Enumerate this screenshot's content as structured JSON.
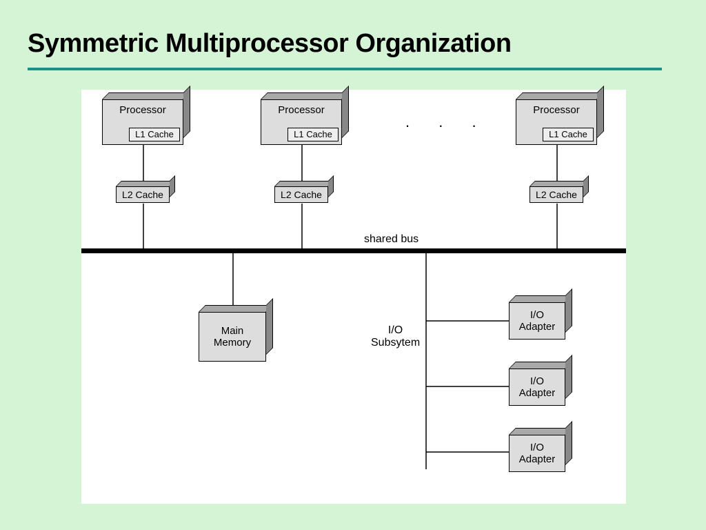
{
  "title": "Symmetric Multiprocessor Organization",
  "labels": {
    "processor": "Processor",
    "l1": "L1 Cache",
    "l2": "L2 Cache",
    "bus": "shared bus",
    "main_memory": "Main\nMemory",
    "io_subsystem": "I/O\nSubsytem",
    "io_adapter": "I/O\nAdapter",
    "ellipsis": ".   .   ."
  },
  "diagram": {
    "processors": 3,
    "io_adapters": 3,
    "ellipsis_after_processor_index": 1,
    "connections": [
      "processor[i] → l1_cache[i] (contained)",
      "processor[i] → l2_cache[i] (vertical)",
      "l2_cache[i] → shared_bus (vertical)",
      "shared_bus → main_memory (vertical)",
      "shared_bus → io_subsystem_trunk (vertical)",
      "io_subsystem_trunk → io_adapter[j] (horizontal branches)"
    ]
  }
}
